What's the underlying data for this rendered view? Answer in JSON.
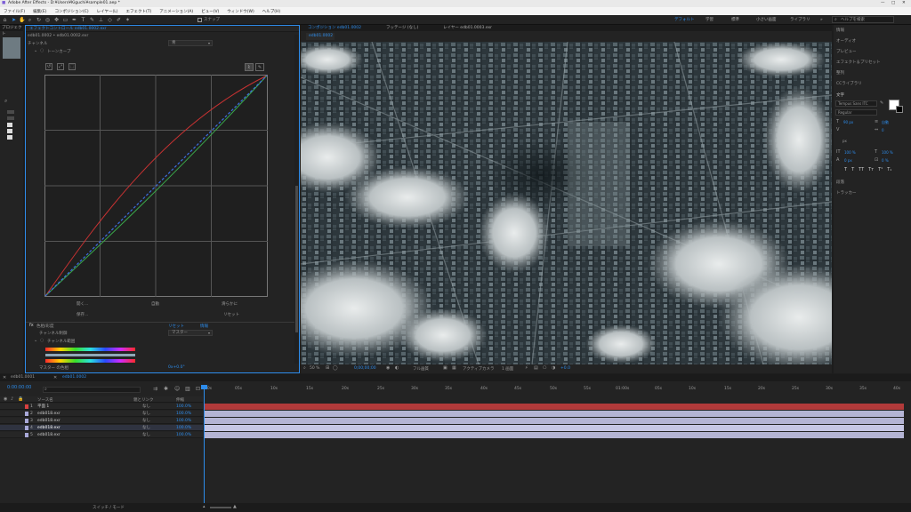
{
  "app_title": "Adobe After Effects - D:¥Users¥Kiguchi¥sample01.aep *",
  "menu": [
    "ファイル(F)",
    "編集(E)",
    "コンポジション(C)",
    "レイヤー(L)",
    "エフェクト(T)",
    "アニメーション(A)",
    "ビュー(V)",
    "ウィンドウ(W)",
    "ヘルプ(H)"
  ],
  "toolbar": {
    "snap_label": "スナップ",
    "workspaces": [
      "デフォルト",
      "学習",
      "標準",
      "小さい画面",
      "ライブラリ"
    ],
    "active_workspace": "デフォルト",
    "help_search_placeholder": "ヘルプを検索"
  },
  "project_panel": {
    "title": "プロジェクト"
  },
  "effect_panel": {
    "tab_label": "エフェクトコントロール edb01.0002.exr",
    "breadcrumb": "edb01.0002 • edb01.0002.exr",
    "channel_label": "チャンネル",
    "channel_value": "青",
    "tone_curve_label": "トーンカーブ",
    "buttons": [
      "開く...",
      "自動",
      "滑らかに",
      "保存...",
      "リセット"
    ],
    "color_balance": {
      "effect_name": "色相/彩度",
      "reset_label": "リセット",
      "about_label": "情報",
      "channel_control_label": "チャンネル制御",
      "channel_control_value": "マスター",
      "channel_range_label": "チャンネル範囲",
      "master_hue_label": "マスター の色相",
      "master_hue_value": "0x+0.0°"
    }
  },
  "composition_panel": {
    "tabs": [
      "コンポジション edb01.0002",
      "フッテージ (なし)",
      "レイヤー edb01.0003.exr"
    ],
    "active_tab": "コンポジション edb01.0002",
    "sub_tab": "edb01.0002",
    "footer": {
      "zoom": "50 %",
      "timecode": "0;00;00;00",
      "resolution": "フル画質",
      "camera": "アクティブカメラ",
      "views": "1 画面",
      "exposure": "+0.0"
    }
  },
  "right_panel": {
    "items": [
      "情報",
      "オーディオ",
      "プレビュー",
      "エフェクト＆プリセット",
      "整列",
      "CCライブラリ"
    ],
    "character_title": "文字",
    "font_family": "Tempus Sans ITC",
    "font_style": "Regular",
    "font_size": "90 px",
    "leading": "自動",
    "tracking": "0",
    "vertical_scale": "100 %",
    "horizontal_scale": "100 %",
    "baseline_shift": "0 px",
    "tsume": "0 %",
    "unit_label": "px",
    "paragraph_title": "段落",
    "tracker_title": "トラッカー",
    "fill_color": "#ffffff",
    "stroke_color": "#000000"
  },
  "timeline": {
    "tabs": [
      "edb01.0001",
      "edb01.0002"
    ],
    "active_tab": "edb01.0002",
    "timecode": "0:00:00:00",
    "search_placeholder": "",
    "columns": [
      "ソース名",
      "親とリンク",
      "伸縮"
    ],
    "layers": [
      {
        "num": "1",
        "name": "平面 1",
        "parent": "なし",
        "stretch": "100.0%",
        "label_color": "#d84040"
      },
      {
        "num": "2",
        "name": "edb018.exr",
        "parent": "なし",
        "stretch": "100.0%",
        "label_color": "#a8a8d8"
      },
      {
        "num": "3",
        "name": "edb018.exr",
        "parent": "なし",
        "stretch": "100.0%",
        "label_color": "#a8a8d8"
      },
      {
        "num": "4",
        "name": "edb018.exr",
        "parent": "なし",
        "stretch": "100.0%",
        "label_color": "#a8a8d8"
      },
      {
        "num": "5",
        "name": "edb018.exr",
        "parent": "なし",
        "stretch": "100.0%",
        "label_color": "#a8a8d8"
      }
    ],
    "ruler": [
      "00s",
      "05s",
      "10s",
      "15s",
      "20s",
      "25s",
      "30s",
      "35s",
      "40s",
      "45s",
      "50s",
      "55s",
      "01:00s",
      "05s",
      "10s",
      "15s",
      "20s",
      "25s",
      "30s",
      "35s",
      "40s"
    ],
    "footer_label": "スイッチ / モード",
    "bar_colors": [
      "#b13a3a",
      "#b4b4d4",
      "#b4b4d4",
      "#b4b4d4",
      "#b4b4d4"
    ]
  }
}
